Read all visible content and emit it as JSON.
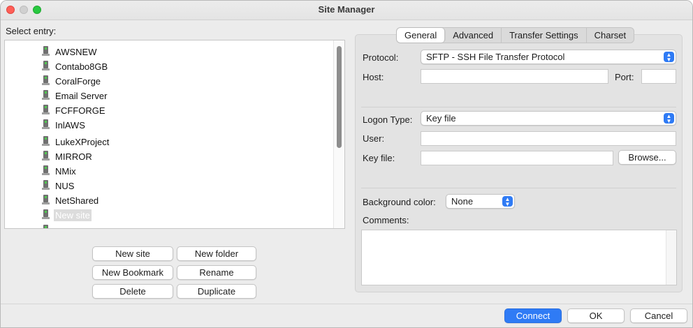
{
  "window": {
    "title": "Site Manager"
  },
  "left": {
    "select_label": "Select entry:",
    "sites": [
      {
        "label": "AWSNEW"
      },
      {
        "label": "Contabo8GB"
      },
      {
        "label": "CoralForge"
      },
      {
        "label": "Email Server"
      },
      {
        "label": "FCFFORGE"
      },
      {
        "label": "InlAWS"
      },
      {
        "label": "LukeXProject"
      },
      {
        "label": "MIRROR"
      },
      {
        "label": "NMix"
      },
      {
        "label": "NUS"
      },
      {
        "label": "NetShared"
      },
      {
        "label": "New site",
        "selected": true
      }
    ],
    "buttons": {
      "new_site": "New site",
      "new_folder": "New folder",
      "new_bookmark": "New Bookmark",
      "rename": "Rename",
      "delete": "Delete",
      "duplicate": "Duplicate"
    }
  },
  "tabs": [
    "General",
    "Advanced",
    "Transfer Settings",
    "Charset"
  ],
  "active_tab": "General",
  "general": {
    "protocol_label": "Protocol:",
    "protocol_value": "SFTP - SSH File Transfer Protocol",
    "host_label": "Host:",
    "host_value": "",
    "port_label": "Port:",
    "port_value": "",
    "logon_type_label": "Logon Type:",
    "logon_type_value": "Key file",
    "user_label": "User:",
    "user_value": "",
    "key_file_label": "Key file:",
    "key_file_value": "",
    "browse_label": "Browse...",
    "bg_color_label": "Background color:",
    "bg_color_value": "None",
    "comments_label": "Comments:",
    "comments_value": ""
  },
  "footer": {
    "connect": "Connect",
    "ok": "OK",
    "cancel": "Cancel"
  },
  "colors": {
    "accent": "#2f7bf5",
    "close": "#ff5f57",
    "maximize": "#28c840"
  },
  "icons": {
    "site": "server-icon",
    "dropdown": "chevron-updown-icon"
  }
}
